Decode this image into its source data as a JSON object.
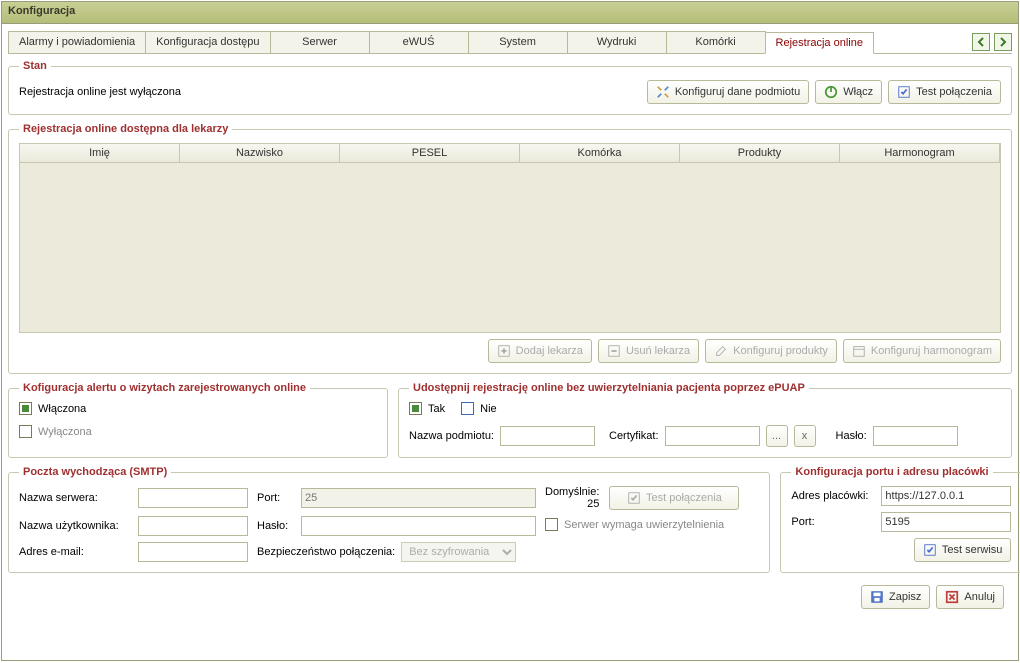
{
  "title": "Konfiguracja",
  "tabs": [
    {
      "label": "Alarmy i powiadomienia"
    },
    {
      "label": "Konfiguracja dostępu"
    },
    {
      "label": "Serwer"
    },
    {
      "label": "eWUŚ"
    },
    {
      "label": "System"
    },
    {
      "label": "Wydruki"
    },
    {
      "label": "Komórki"
    },
    {
      "label": "Rejestracja online",
      "active": true
    }
  ],
  "stan": {
    "legend": "Stan",
    "status": "Rejestracja online jest wyłączona",
    "btn_konfig": "Konfiguruj dane podmiotu",
    "btn_wlacz": "Włącz",
    "btn_test": "Test połączenia"
  },
  "lekarze": {
    "legend": "Rejestracja online dostępna dla lekarzy",
    "cols": {
      "imie": "Imię",
      "nazw": "Nazwisko",
      "pesel": "PESEL",
      "kom": "Komórka",
      "prod": "Produkty",
      "harm": "Harmonogram"
    },
    "btn_add": "Dodaj lekarza",
    "btn_del": "Usuń lekarza",
    "btn_prod": "Konfiguruj produkty",
    "btn_harm": "Konfiguruj harmonogram"
  },
  "alert": {
    "legend": "Kofiguracja alertu o wizytach zarejestrowanych online",
    "on": "Włączona",
    "off": "Wyłączona"
  },
  "epuap": {
    "legend": "Udostępnij rejestrację online bez uwierzytelniania pacjenta poprzez ePUAP",
    "tak": "Tak",
    "nie": "Nie",
    "lbl_nazwa": "Nazwa podmiotu:",
    "lbl_cert": "Certyfikat:",
    "browse": "...",
    "clear": "x",
    "lbl_haslo": "Hasło:"
  },
  "smtp": {
    "legend": "Poczta wychodząca (SMTP)",
    "lbl_server": "Nazwa serwera:",
    "lbl_port": "Port:",
    "lbl_default": "Domyślnie: 25",
    "port_placeholder": "25",
    "btn_test": "Test połączenia",
    "lbl_user": "Nazwa użytkownika:",
    "lbl_pass": "Hasło:",
    "chk_auth": "Serwer wymaga uwierzytelnienia",
    "lbl_email": "Adres e-mail:",
    "lbl_sec": "Bezpieczeństwo połączenia:",
    "sec_value": "Bez szyfrowania"
  },
  "port": {
    "legend": "Konfiguracja portu i adresu placówki",
    "lbl_addr": "Adres placówki:",
    "addr": "https://127.0.0.1",
    "lbl_port": "Port:",
    "port": "5195",
    "btn_test": "Test serwisu"
  },
  "footer": {
    "save": "Zapisz",
    "cancel": "Anuluj"
  }
}
